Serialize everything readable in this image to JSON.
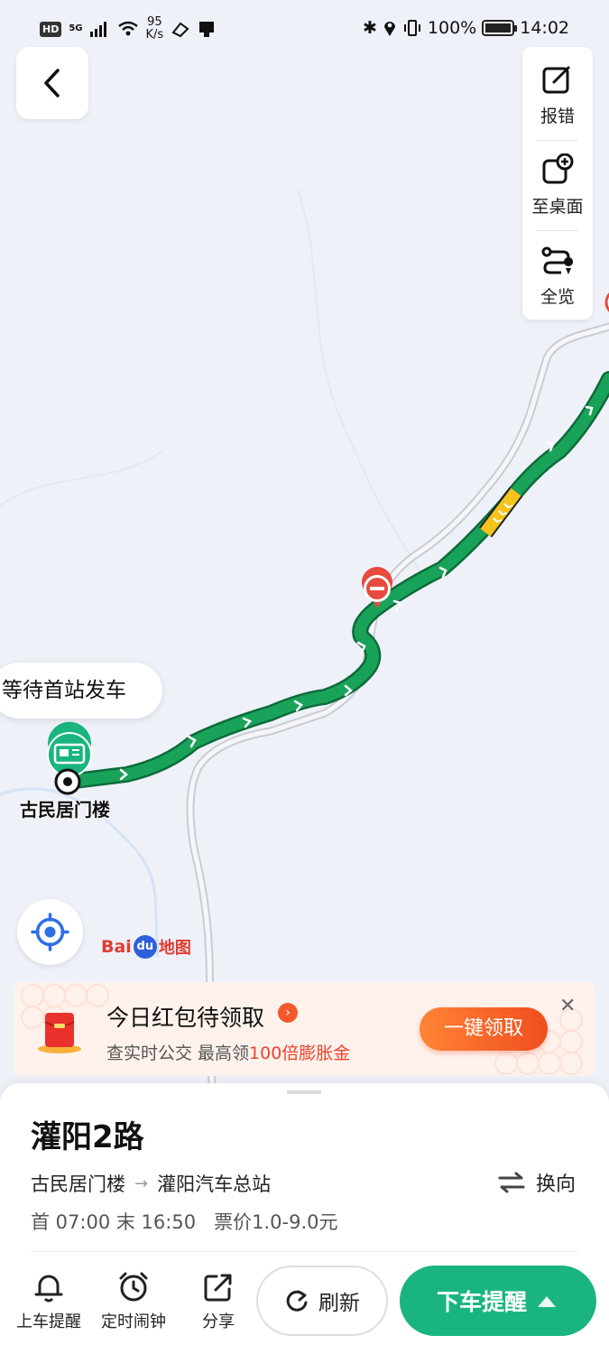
{
  "status_bar": {
    "hd": "HD",
    "network": "5G",
    "speed_value": "95",
    "speed_unit": "K/s",
    "battery": "100%",
    "time": "14:02"
  },
  "map": {
    "waiting_bubble": "等待首站发车",
    "origin_stop": "古民居门楼",
    "brand": {
      "bai": "Bai",
      "du": "du",
      "map": "地图"
    },
    "route_color": "#19a35a",
    "congestion_color": "#f5c31c"
  },
  "right_tools": [
    {
      "label": "报错",
      "icon": "edit-icon"
    },
    {
      "label": "至桌面",
      "icon": "add-desktop-icon"
    },
    {
      "label": "全览",
      "icon": "route-overview-icon"
    }
  ],
  "promo": {
    "title": "今日红包待领取",
    "subtitle_prefix": "查实时公交 最高领",
    "subtitle_highlight": "100倍膨胀金",
    "button": "一键领取",
    "close": "✕",
    "accent": "#f04d1e"
  },
  "route": {
    "name": "灌阳2路",
    "from": "古民居门楼",
    "to": "灌阳汽车总站",
    "switch_label": "换向",
    "times": "首 07:00 末 16:50",
    "fare": "票价1.0-9.0元"
  },
  "actions": {
    "boarding_alert": "上车提醒",
    "timer_alarm": "定时闹钟",
    "share": "分享",
    "refresh": "刷新",
    "alight_alert": "下车提醒",
    "primary_color": "#1ab57f"
  }
}
